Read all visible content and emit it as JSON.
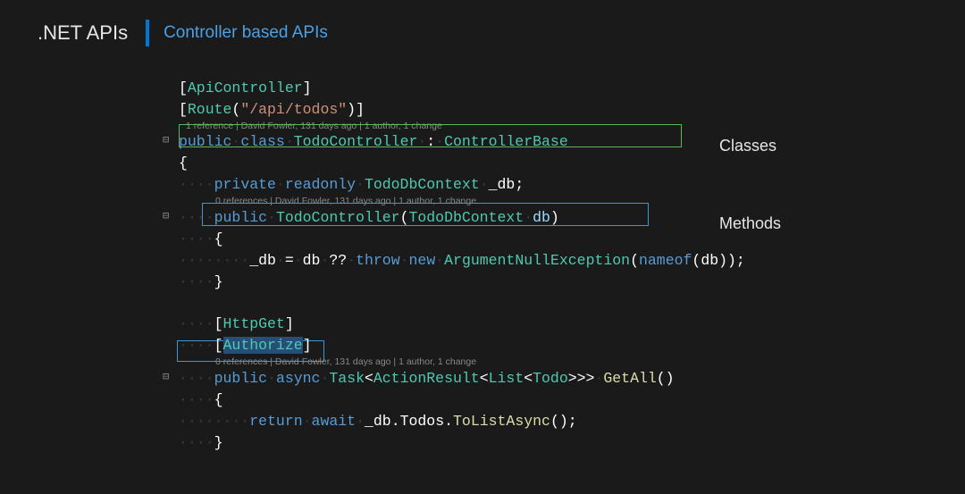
{
  "header": {
    "title": ".NET APIs",
    "subtitle": "Controller based APIs"
  },
  "annotations": {
    "classes": "Classes",
    "methods": "Methods"
  },
  "codelens": {
    "class": "1 reference | David Fowler, 131 days ago | 1 author, 1 change",
    "ctor": "0 references | David Fowler, 131 days ago | 1 author, 1 change",
    "method": "0 references | David Fowler, 131 days ago | 1 author, 1 change"
  },
  "code": {
    "attr_apicontroller": "ApiController",
    "attr_route": "Route",
    "route_path": "\"/api/todos\"",
    "kw_public": "public",
    "kw_class": "class",
    "kw_private": "private",
    "kw_readonly": "readonly",
    "kw_throw": "throw",
    "kw_new": "new",
    "kw_nameof": "nameof",
    "kw_async": "async",
    "kw_return": "return",
    "kw_await": "await",
    "class_name": "TodoController",
    "base_class": "ControllerBase",
    "dbcontext_type": "TodoDbContext",
    "db_field": "_db",
    "db_param": "db",
    "exception": "ArgumentNullException",
    "attr_httpget": "HttpGet",
    "attr_authorize": "Authorize",
    "task": "Task",
    "actionresult": "ActionResult",
    "list": "List",
    "todo": "Todo",
    "getall": "GetAll",
    "todos_prop": "Todos",
    "tolistasync": "ToListAsync"
  }
}
